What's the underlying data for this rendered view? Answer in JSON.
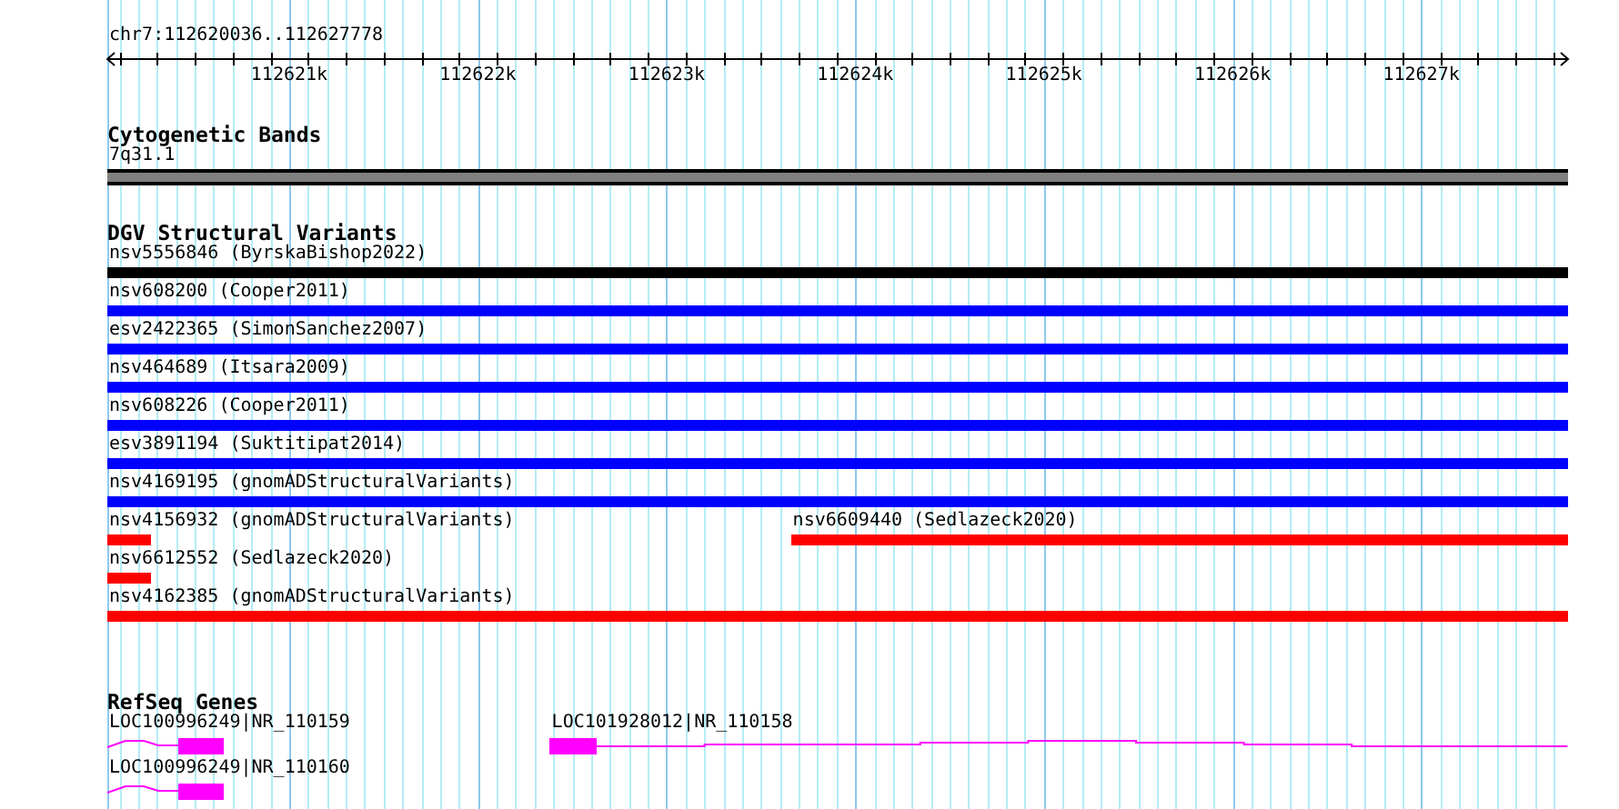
{
  "ruler": {
    "location": "chr7:112620036..112627778",
    "ticks": [
      "112621k",
      "112622k",
      "112623k",
      "112624k",
      "112625k",
      "112626k",
      "112627k"
    ]
  },
  "tracks": [
    {
      "title": "Cytogenetic Bands",
      "kind": "bands",
      "rows": [
        [
          {
            "label": "7q31.1"
          }
        ]
      ]
    },
    {
      "title": "DGV Structural Variants",
      "kind": "variants",
      "rows": [
        [
          {
            "label": "nsv5556846 (ByrskaBishop2022)",
            "color": "#000000"
          }
        ],
        [
          {
            "label": "nsv608200 (Cooper2011)",
            "color": "#0000ff"
          }
        ],
        [
          {
            "label": "esv2422365 (SimonSanchez2007)",
            "color": "#0000ff"
          }
        ],
        [
          {
            "label": "nsv464689 (Itsara2009)",
            "color": "#0000ff"
          }
        ],
        [
          {
            "label": "nsv608226 (Cooper2011)",
            "color": "#0000ff"
          }
        ],
        [
          {
            "label": "esv3891194 (Suktitipat2014)",
            "color": "#0000ff"
          }
        ],
        [
          {
            "label": "nsv4169195 (gnomADStructuralVariants)",
            "color": "#0000ff"
          }
        ],
        [
          {
            "label": "nsv4156932 (gnomADStructuralVariants)",
            "color": "#ff0000"
          },
          {
            "label": "nsv6609440 (Sedlazeck2020)",
            "color": "#ff0000"
          }
        ],
        [
          {
            "label": "nsv6612552 (Sedlazeck2020)",
            "color": "#ff0000"
          }
        ],
        [
          {
            "label": "nsv4162385 (gnomADStructuralVariants)",
            "color": "#ff0000"
          }
        ]
      ]
    },
    {
      "title": "RefSeq Genes",
      "kind": "genes",
      "rows": [
        [
          {
            "label": "LOC100996249|NR_110159"
          },
          {
            "label": "LOC101928012|NR_110158"
          }
        ],
        [
          {
            "label": "LOC100996249|NR_110160"
          }
        ]
      ]
    }
  ]
}
